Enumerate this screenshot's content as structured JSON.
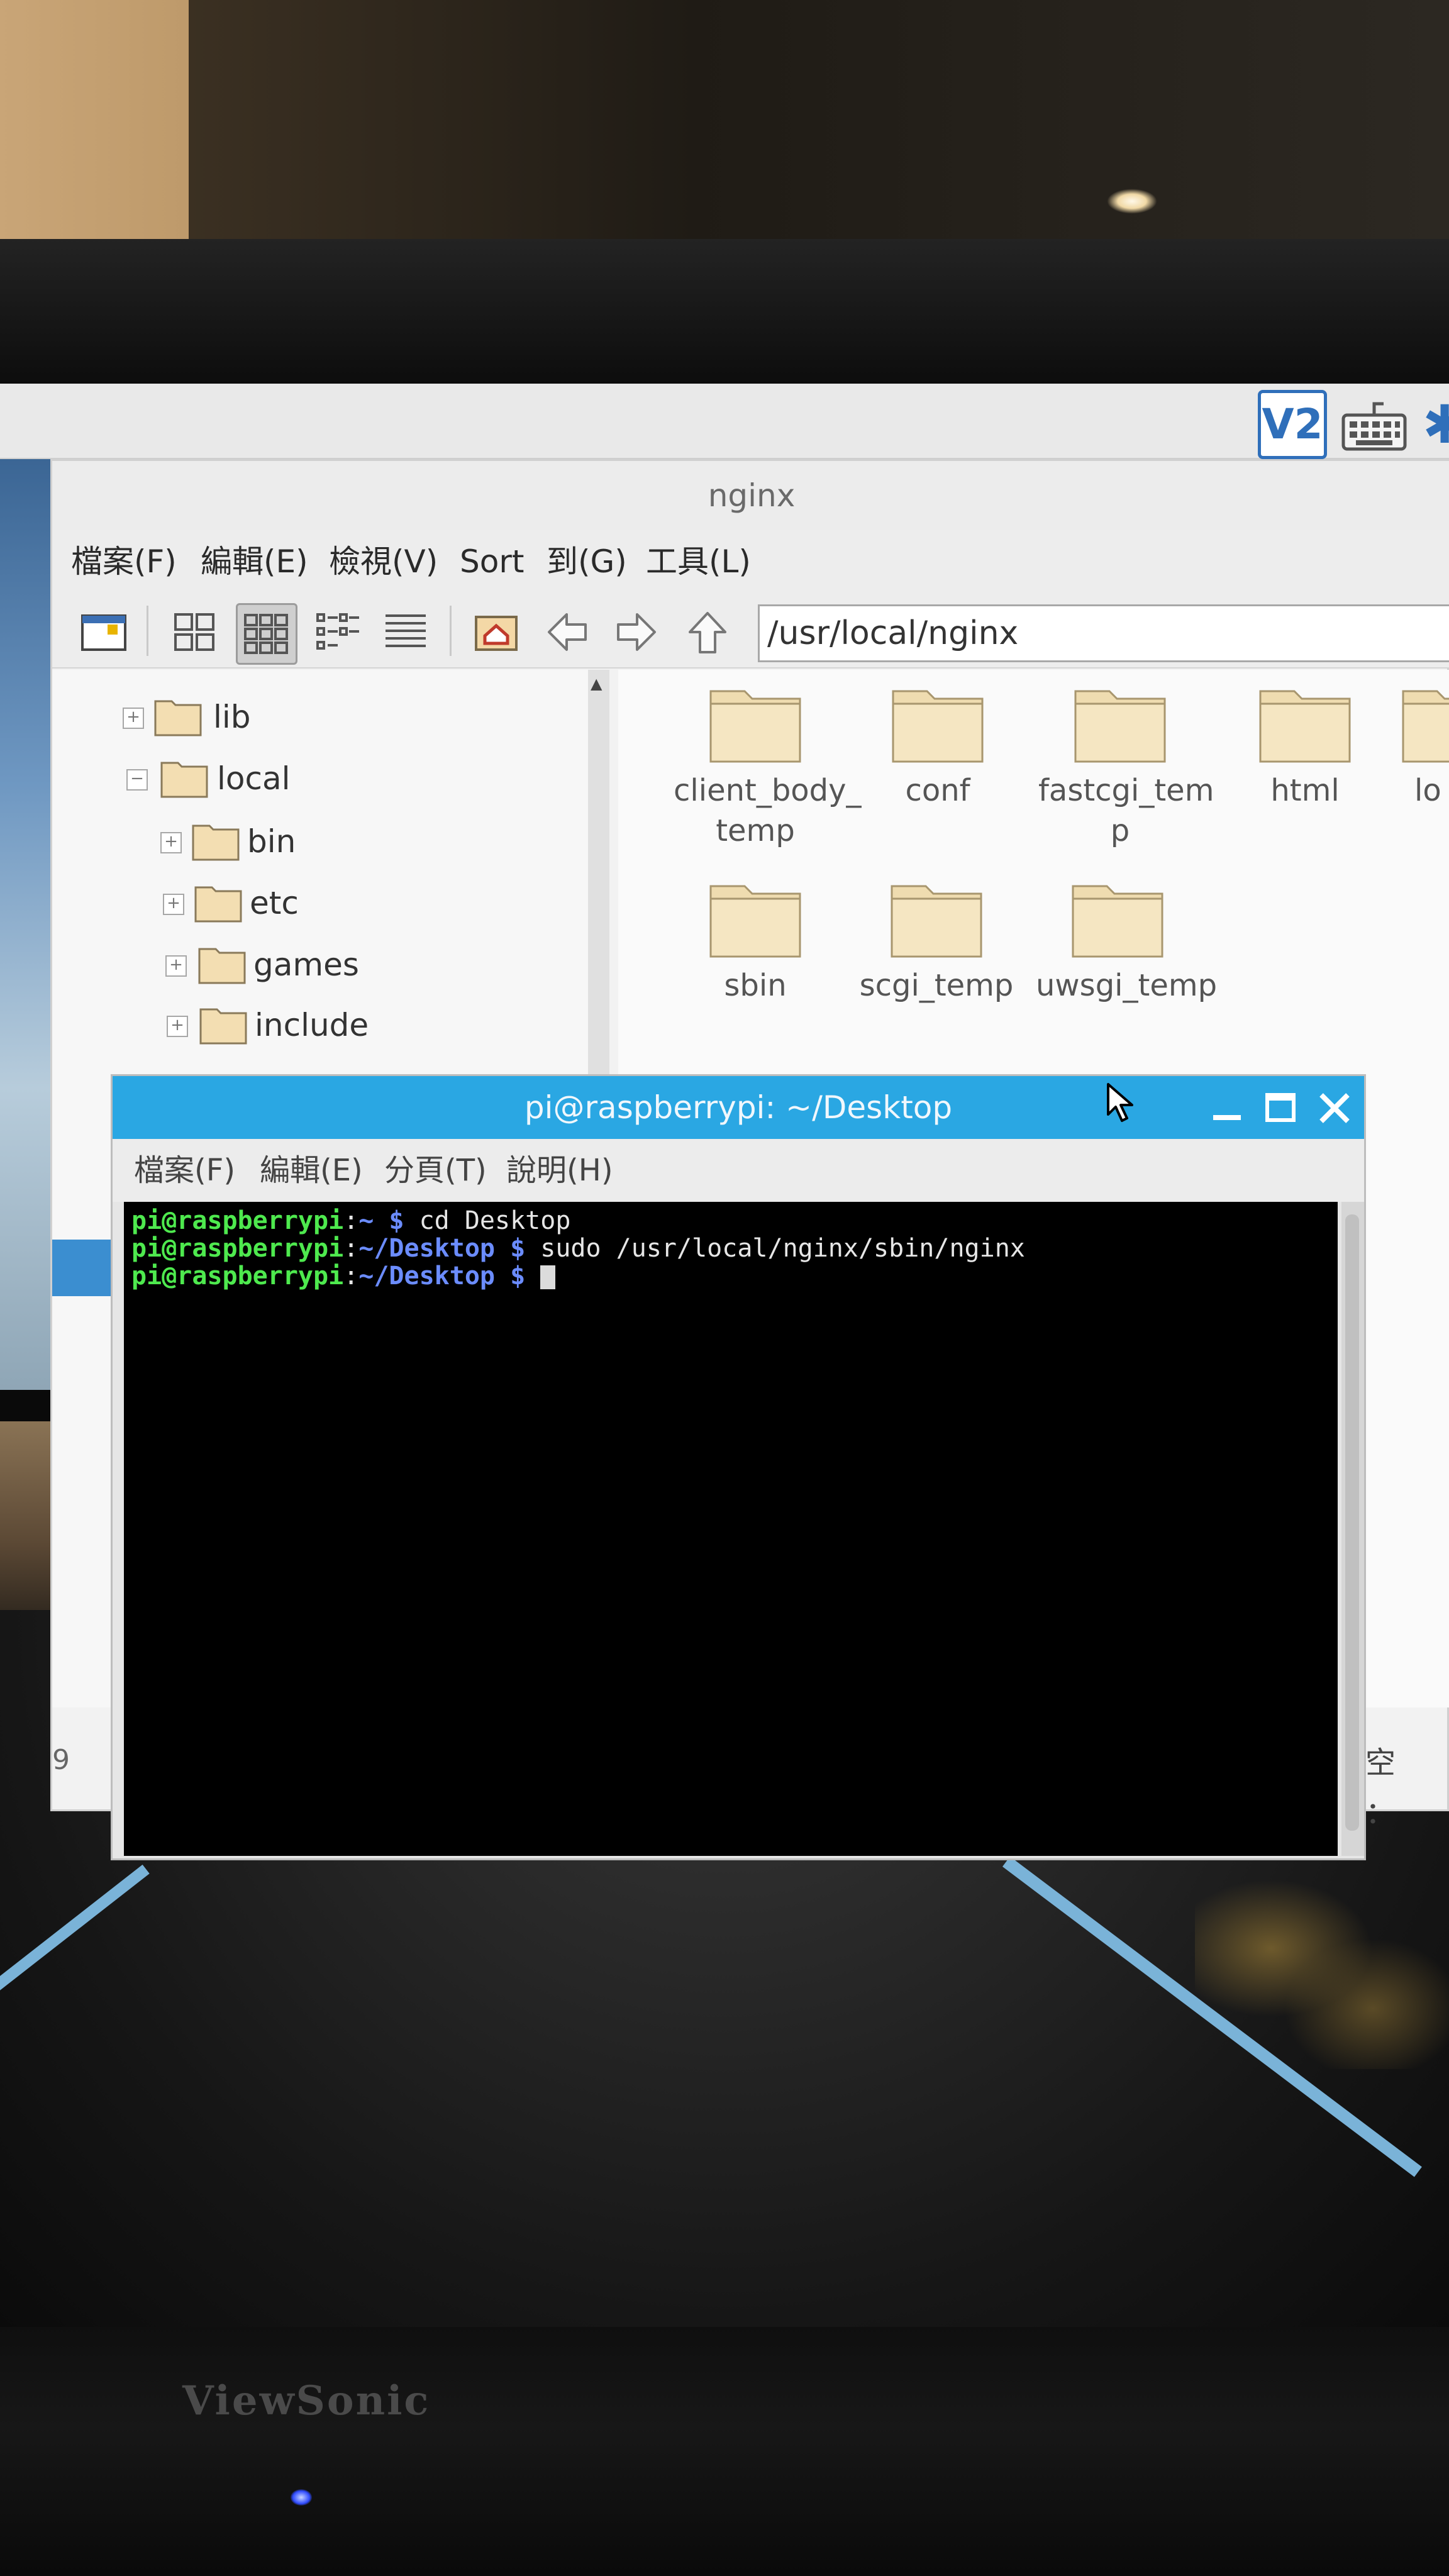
{
  "monitor": {
    "brand": "ViewSonic"
  },
  "taskbar": {
    "vnc_icon_text": "V2"
  },
  "file_manager": {
    "title": "nginx",
    "menu": [
      "檔案(F)",
      "編輯(E)",
      "檢視(V)",
      "Sort",
      "到(G)",
      "工具(L)"
    ],
    "path": "/usr/local/nginx",
    "toolbar_icons": [
      "new-window-icon",
      "icon-view-icon",
      "thumbnail-view-icon",
      "compact-view-icon",
      "detailed-list-icon",
      "home-icon",
      "back-arrow-icon",
      "forward-arrow-icon",
      "up-arrow-icon"
    ],
    "tree": [
      {
        "label": "lib",
        "expander": "+"
      },
      {
        "label": "local",
        "expander": "−"
      },
      {
        "label": "bin",
        "expander": "+"
      },
      {
        "label": "etc",
        "expander": "+"
      },
      {
        "label": "games",
        "expander": "+"
      },
      {
        "label": "include",
        "expander": "+"
      }
    ],
    "folders": [
      {
        "label": "client_body_\ntemp"
      },
      {
        "label": "conf"
      },
      {
        "label": "fastcgi_tem\np"
      },
      {
        "label": "html"
      },
      {
        "label": "lo"
      },
      {
        "label": "sbin"
      },
      {
        "label": "scgi_temp"
      },
      {
        "label": "uwsgi_temp"
      }
    ],
    "status_left": "9",
    "status_right": "用空間："
  },
  "terminal": {
    "title": "pi@raspberrypi: ~/Desktop",
    "menu": [
      "檔案(F)",
      "編輯(E)",
      "分頁(T)",
      "說明(H)"
    ],
    "lines": [
      {
        "user": "pi@raspberrypi",
        "sep": ":",
        "path": "~",
        "dollar": " $ ",
        "cmd": "cd Desktop"
      },
      {
        "user": "pi@raspberrypi",
        "sep": ":",
        "path": "~/Desktop",
        "dollar": " $ ",
        "cmd": "sudo /usr/local/nginx/sbin/nginx"
      },
      {
        "user": "pi@raspberrypi",
        "sep": ":",
        "path": "~/Desktop",
        "dollar": " $ ",
        "cmd": ""
      }
    ]
  }
}
